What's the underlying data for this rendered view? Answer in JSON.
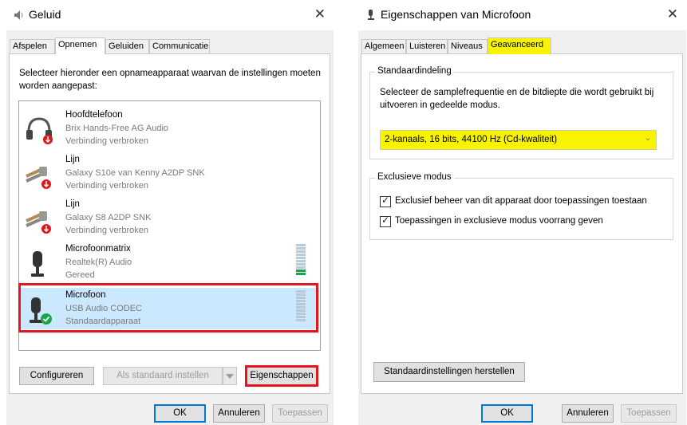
{
  "sound_dialog": {
    "title": "Geluid",
    "close_glyph": "✕",
    "tabs": [
      {
        "label": "Afspelen",
        "active": false
      },
      {
        "label": "Opnemen",
        "active": true
      },
      {
        "label": "Geluiden",
        "active": false
      },
      {
        "label": "Communicatie",
        "active": false
      }
    ],
    "description": "Selecteer hieronder een opnameapparaat waarvan de instellingen moeten worden aangepast:",
    "devices": [
      {
        "name": "Hoofdtelefoon",
        "sub": "Brix Hands-Free AG Audio",
        "status": "Verbinding verbroken",
        "icon": "headset-icon"
      },
      {
        "name": "Lijn",
        "sub": "Galaxy S10e van Kenny A2DP SNK",
        "status": "Verbinding verbroken",
        "icon": "line-in-cable-icon"
      },
      {
        "name": "Lijn",
        "sub": "Galaxy S8 A2DP SNK",
        "status": "Verbinding verbroken",
        "icon": "line-in-cable-icon"
      },
      {
        "name": "Microfoonmatrix",
        "sub": "Realtek(R) Audio",
        "status": "Gereed",
        "icon": "microphone-icon"
      },
      {
        "name": "Microfoon",
        "sub": "USB Audio CODEC",
        "status": "Standaardapparaat",
        "icon": "microphone-default-icon",
        "selected": true
      }
    ],
    "buttons": {
      "configure": "Configureren",
      "set_default": "Als standaard instellen",
      "properties": "Eigenschappen",
      "ok": "OK",
      "cancel": "Annuleren",
      "apply": "Toepassen"
    }
  },
  "properties_dialog": {
    "title": "Eigenschappen van Microfoon",
    "close_glyph": "✕",
    "tabs": [
      {
        "label": "Algemeen",
        "active": false
      },
      {
        "label": "Luisteren",
        "active": false
      },
      {
        "label": "Niveaus",
        "active": false
      },
      {
        "label": "Geavanceerd",
        "active": true
      }
    ],
    "default_format": {
      "group_label": "Standaardindeling",
      "description": "Selecteer de samplefrequentie en de bitdiepte die wordt gebruikt bij uitvoeren in gedeelde modus.",
      "selected_value": "2-kanaals, 16 bits, 44100 Hz (Cd-kwaliteit)",
      "arrow_glyph": "⌄"
    },
    "exclusive_mode": {
      "group_label": "Exclusieve modus",
      "options": [
        {
          "label": "Exclusief beheer van dit apparaat door toepassingen toestaan",
          "checked": true
        },
        {
          "label": "Toepassingen in exclusieve modus voorrang geven",
          "checked": true
        }
      ]
    },
    "buttons": {
      "restore_defaults": "Standaardinstellingen herstellen",
      "ok": "OK",
      "cancel": "Annuleren",
      "apply": "Toepassen"
    }
  },
  "colors": {
    "highlight": "#f8f400",
    "selection": "#cce8ff",
    "red_outline": "#e0181b",
    "focus_blue": "#0078d7",
    "status_ok": "#1ea54c",
    "status_disconnected": "#e0181b"
  }
}
